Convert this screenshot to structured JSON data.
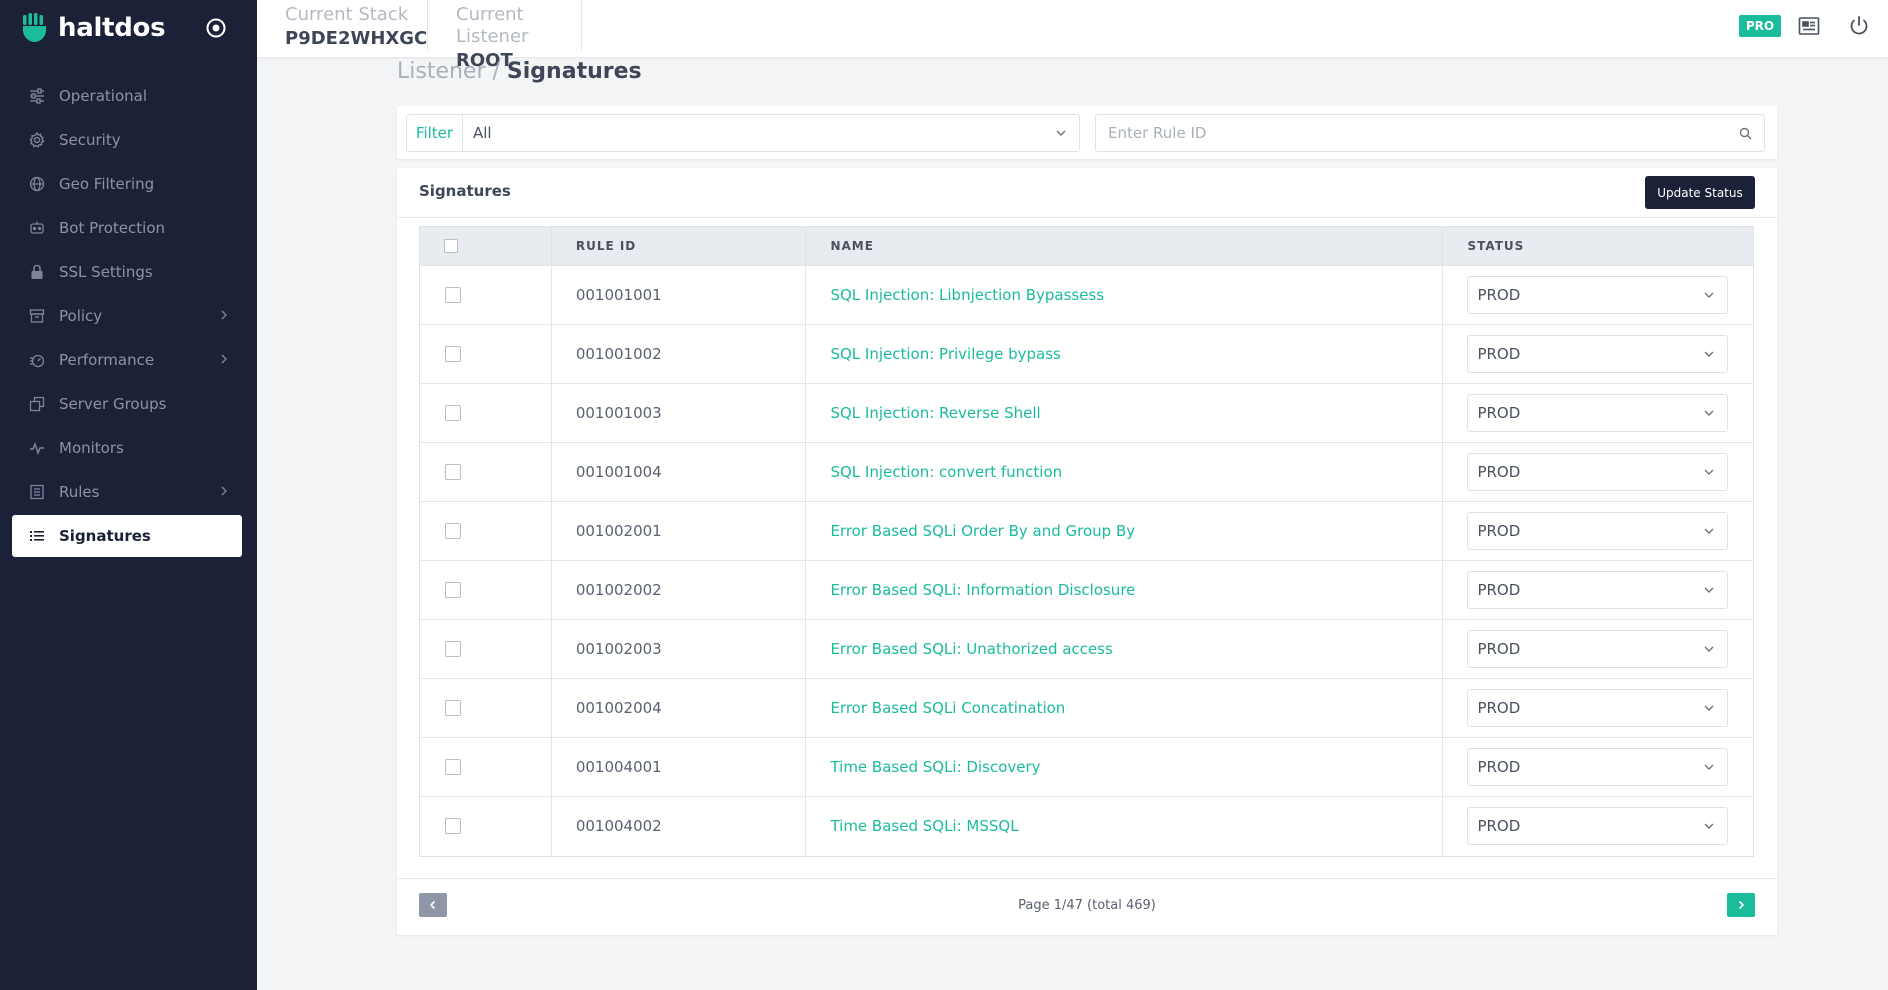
{
  "app": {
    "brand": "haltdos"
  },
  "colors": {
    "accent": "#1abc9c",
    "sidebar": "#1b2238",
    "button_dark": "#1b2238"
  },
  "sidebar": {
    "items": [
      {
        "label": "Operational",
        "icon": "sliders-icon",
        "has_submenu": false,
        "active": false
      },
      {
        "label": "Security",
        "icon": "gear-icon",
        "has_submenu": false,
        "active": false
      },
      {
        "label": "Geo Filtering",
        "icon": "globe-icon",
        "has_submenu": false,
        "active": false
      },
      {
        "label": "Bot Protection",
        "icon": "bot-icon",
        "has_submenu": false,
        "active": false
      },
      {
        "label": "SSL Settings",
        "icon": "lock-icon",
        "has_submenu": false,
        "active": false
      },
      {
        "label": "Policy",
        "icon": "archive-icon",
        "has_submenu": true,
        "active": false
      },
      {
        "label": "Performance",
        "icon": "speedometer-icon",
        "has_submenu": true,
        "active": false
      },
      {
        "label": "Server Groups",
        "icon": "copy-icon",
        "has_submenu": false,
        "active": false
      },
      {
        "label": "Monitors",
        "icon": "pulse-icon",
        "has_submenu": false,
        "active": false
      },
      {
        "label": "Rules",
        "icon": "document-icon",
        "has_submenu": true,
        "active": false
      },
      {
        "label": "Signatures",
        "icon": "list-icon",
        "has_submenu": false,
        "active": true
      }
    ]
  },
  "topbar": {
    "stack": {
      "label": "Current Stack",
      "value": "P9DE2WHXGC"
    },
    "listener": {
      "label": "Current Listener",
      "value": "ROOT"
    },
    "badge": "PRO"
  },
  "breadcrumb": {
    "parent": "Listener",
    "separator": " / ",
    "current": "Signatures"
  },
  "filter": {
    "label": "Filter",
    "selected": "All",
    "search_placeholder": "Enter Rule ID",
    "search_value": ""
  },
  "signatures": {
    "title": "Signatures",
    "update_button": "Update Status",
    "columns": [
      "RULE ID",
      "NAME",
      "STATUS"
    ],
    "rows": [
      {
        "rule_id": "001001001",
        "name": "SQL Injection: Libnjection Bypassess",
        "status": "PROD"
      },
      {
        "rule_id": "001001002",
        "name": "SQL Injection: Privilege bypass",
        "status": "PROD"
      },
      {
        "rule_id": "001001003",
        "name": "SQL Injection: Reverse Shell",
        "status": "PROD"
      },
      {
        "rule_id": "001001004",
        "name": "SQL Injection: convert function",
        "status": "PROD"
      },
      {
        "rule_id": "001002001",
        "name": "Error Based SQLi Order By and Group By",
        "status": "PROD"
      },
      {
        "rule_id": "001002002",
        "name": "Error Based SQLi: Information Disclosure",
        "status": "PROD"
      },
      {
        "rule_id": "001002003",
        "name": "Error Based SQLi: Unathorized access",
        "status": "PROD"
      },
      {
        "rule_id": "001002004",
        "name": "Error Based SQLi Concatination",
        "status": "PROD"
      },
      {
        "rule_id": "001004001",
        "name": "Time Based SQLi: Discovery",
        "status": "PROD"
      },
      {
        "rule_id": "001004002",
        "name": "Time Based SQLi: MSSQL",
        "status": "PROD"
      }
    ],
    "pagination": "Page 1/47 (total 469)"
  }
}
